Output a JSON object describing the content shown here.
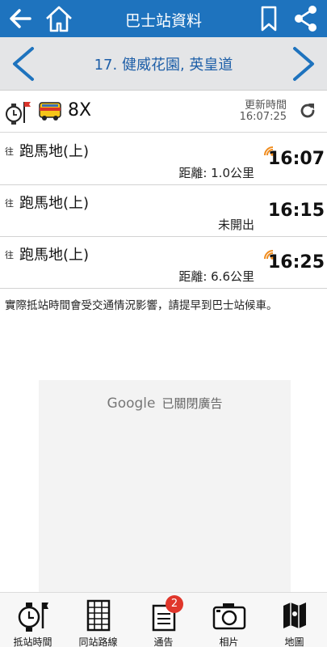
{
  "header": {
    "title": "巴士站資料",
    "icons": [
      "back-arrow-icon",
      "home-icon",
      "bookmark-icon",
      "share-icon"
    ],
    "bg_color": "#1e73be"
  },
  "stop": {
    "name": "17. 健威花園, 英皇道",
    "icons": [
      "chevron-left-icon",
      "chevron-right-icon"
    ]
  },
  "route": {
    "number": "8X",
    "updated_label": "更新時間",
    "updated_time": "16:07:25",
    "icons": [
      "clock-flag-icon",
      "bus-icon",
      "refresh-icon"
    ]
  },
  "etas": [
    {
      "to": "往",
      "destination": "跑馬地(上)",
      "note": "距離: 1.0公里",
      "time": "16:07",
      "realtime": true
    },
    {
      "to": "往",
      "destination": "跑馬地(上)",
      "note": "未開出",
      "time": "16:15",
      "realtime": false
    },
    {
      "to": "往",
      "destination": "跑馬地(上)",
      "note": "距離: 6.6公里",
      "time": "16:25",
      "realtime": true
    }
  ],
  "disclaimer": "實際抵站時間會受交通情況影響，請提早到巴士站候車。",
  "ad": {
    "brand": "Google",
    "text": "已關閉廣告"
  },
  "bottom_nav": [
    {
      "label": "抵站時間",
      "icon": "clock-flag-icon"
    },
    {
      "label": "同站路線",
      "icon": "grid-list-icon"
    },
    {
      "label": "通告",
      "icon": "notice-icon",
      "badge": "2"
    },
    {
      "label": "相片",
      "icon": "camera-icon"
    },
    {
      "label": "地圖",
      "icon": "map-icon"
    }
  ],
  "accent_colors": {
    "realtime": "#f08c1e",
    "badge": "#e0362b",
    "stop_text": "#1e5fa8"
  }
}
